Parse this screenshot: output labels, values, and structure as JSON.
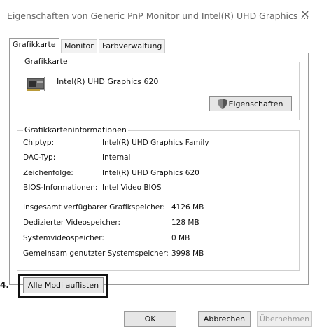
{
  "window": {
    "title": "Eigenschaften von Generic PnP Monitor und Intel(R) UHD Graphics ...",
    "close_glyph": "✕"
  },
  "tabs": [
    {
      "label": "Grafikkarte",
      "active": true
    },
    {
      "label": "Monitor",
      "active": false
    },
    {
      "label": "Farbverwaltung",
      "active": false
    }
  ],
  "adapter_group": {
    "title": "Grafikkarte",
    "adapter_name": "Intel(R) UHD Graphics 620",
    "properties_button": "Eigenschaften"
  },
  "info_group": {
    "title": "Grafikkarteninformationen",
    "rows": [
      {
        "label": "Chiptyp:",
        "value": "Intel(R) UHD Graphics Family"
      },
      {
        "label": "DAC-Typ:",
        "value": "Internal"
      },
      {
        "label": "Zeichenfolge:",
        "value": "Intel(R) UHD Graphics 620"
      },
      {
        "label": "BIOS-Informationen:",
        "value": "Intel Video BIOS"
      }
    ],
    "memory_rows": [
      {
        "label": "Insgesamt verfügbarer Grafikspeicher:",
        "value": "4126 MB"
      },
      {
        "label": "Dedizierter Videospeicher:",
        "value": "128 MB"
      },
      {
        "label": "Systemvideospeicher:",
        "value": "0 MB"
      },
      {
        "label": "Gemeinsam genutzter Systemspeicher:",
        "value": "3998 MB"
      }
    ]
  },
  "list_modes_button": "Alle Modi auflisten",
  "callout_number": "4.",
  "footer": {
    "ok": "OK",
    "cancel": "Abbrechen",
    "apply": "Übernehmen"
  }
}
